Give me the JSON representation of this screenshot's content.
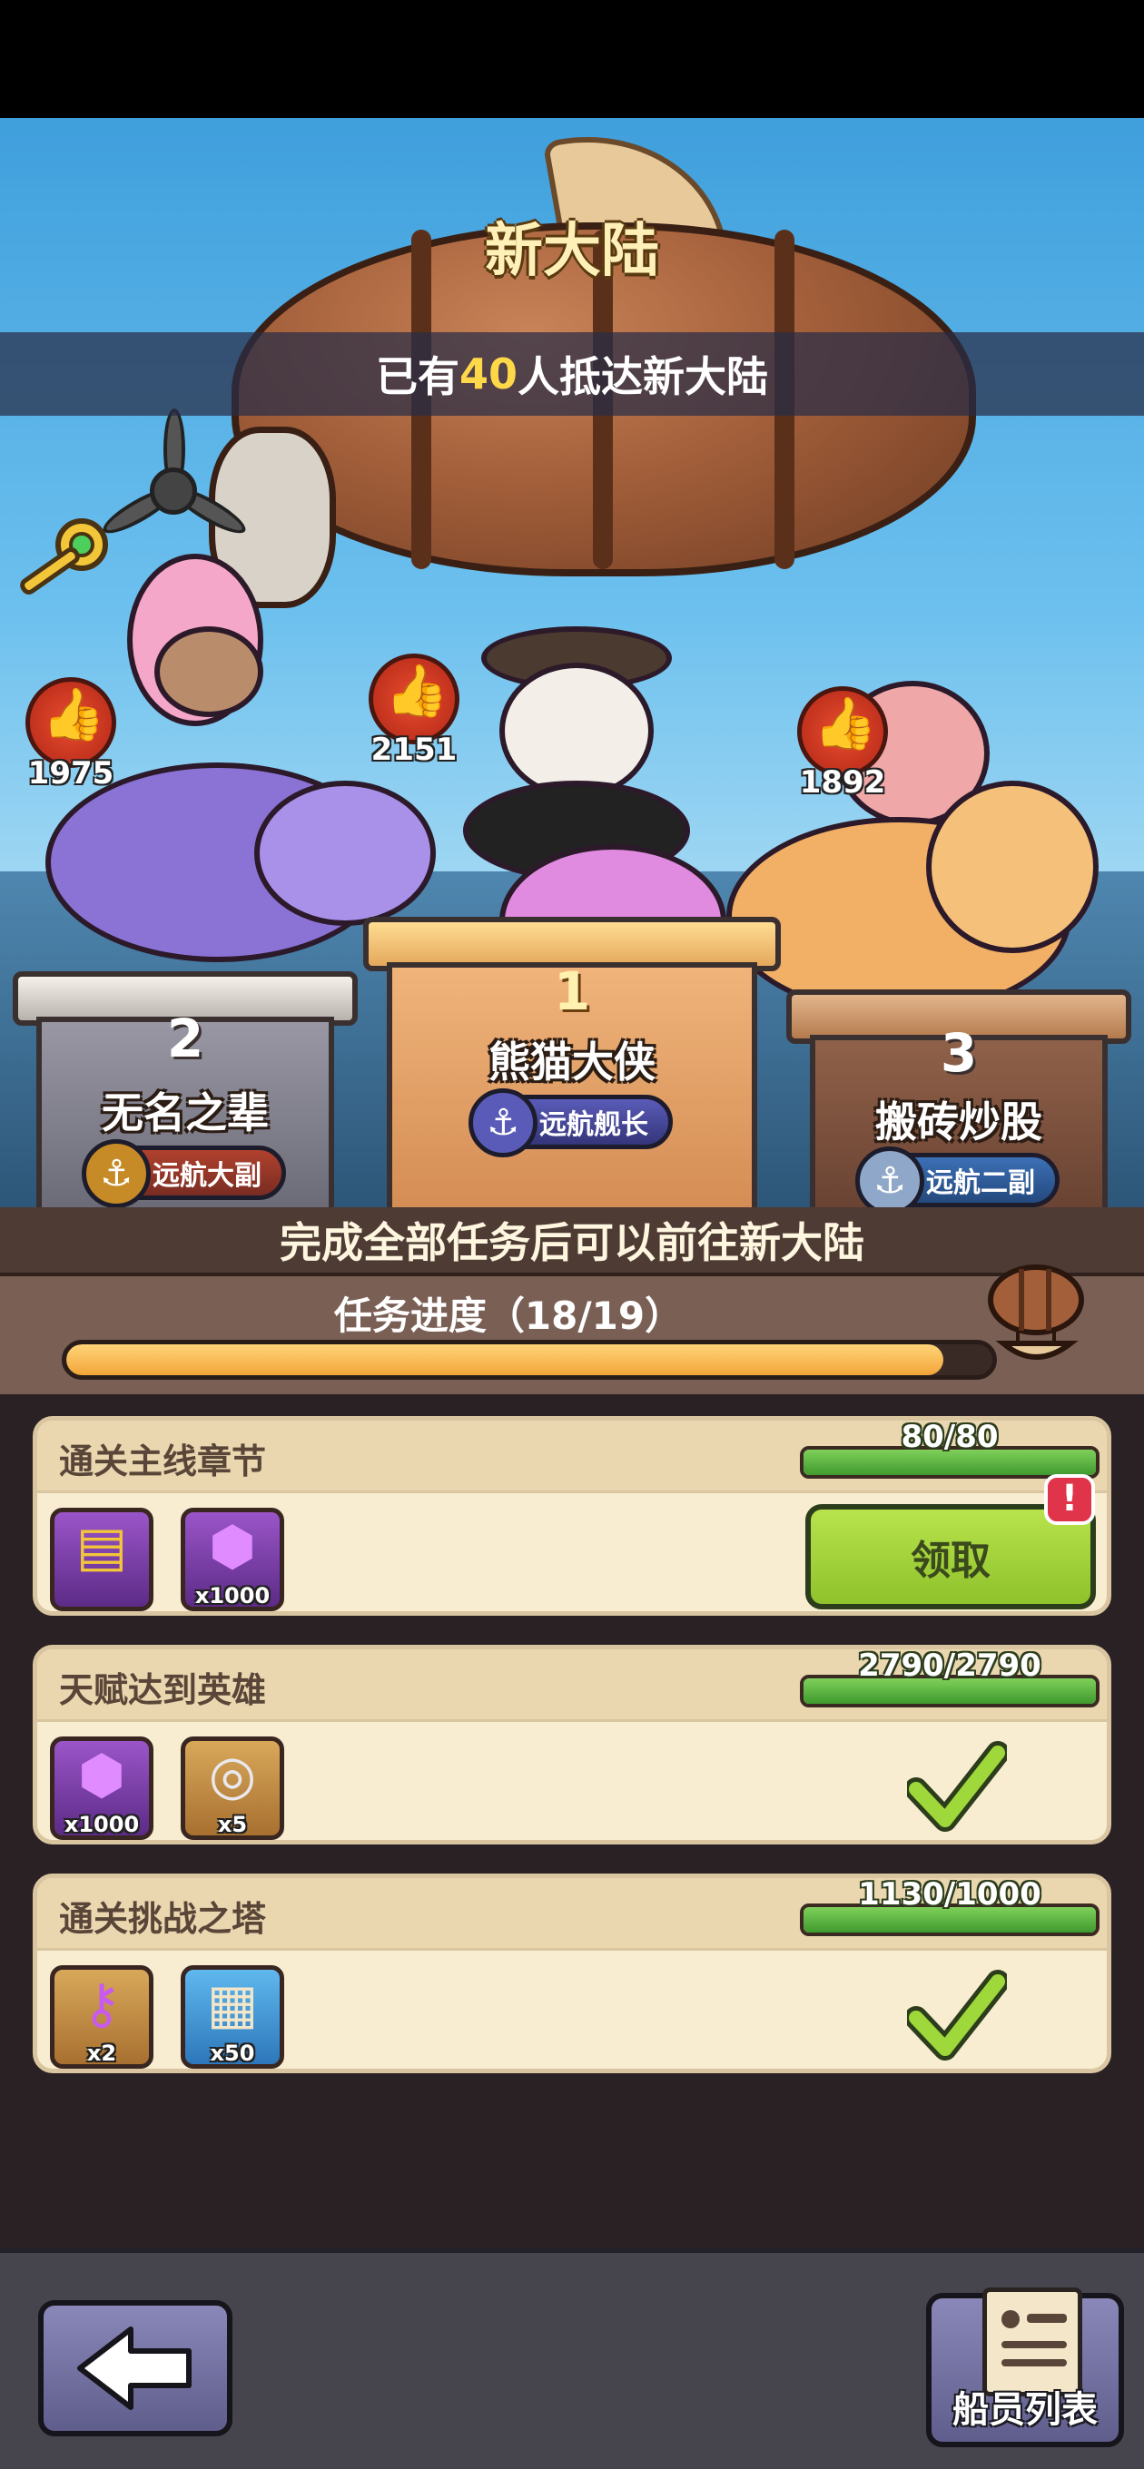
{
  "colors": {
    "sky_top": "#3f9fdc",
    "accent_gold": "#ffd84a",
    "gold_podium": "#e3a667",
    "progress_orange": "#f2a53a",
    "task_green": "#7fd05a",
    "claim_green": "#b8e34c",
    "alert_red": "#e0344a"
  },
  "header": {
    "title": "新大陆",
    "arrived_prefix": "已有",
    "arrived_count": "40",
    "arrived_suffix": "人抵达新大陆"
  },
  "leaderboard": [
    {
      "rank": "1",
      "name": "熊猫大侠",
      "title": "远航舰长",
      "likes": "2151",
      "badge_color": "#3c3d8a"
    },
    {
      "rank": "2",
      "name": "无名之辈",
      "title": "远航大副",
      "likes": "1975",
      "badge_color": "#7a2c22"
    },
    {
      "rank": "3",
      "name": "搬砖炒股",
      "title": "远航二副",
      "likes": "1892",
      "badge_color": "#2a4f84"
    }
  ],
  "unlock_notice": "完成全部任务后可以前往新大陆",
  "progress": {
    "label": "任务进度（18/19）",
    "current": 18,
    "total": 19
  },
  "tasks": [
    {
      "name": "通关主线章节",
      "count": "80/80",
      "fraction": 1.0,
      "rewards": [
        {
          "icon": "treasure-chest-icon",
          "glyph": "▤",
          "qty": "",
          "bg": "purple"
        },
        {
          "icon": "purple-gem-icon",
          "glyph": "⬢",
          "qty": "x1000",
          "bg": "purple"
        }
      ],
      "status": "claim",
      "claim_label": "领取",
      "alert_label": "!"
    },
    {
      "name": "天赋达到英雄",
      "count": "2790/2790",
      "fraction": 1.0,
      "rewards": [
        {
          "icon": "purple-gem-icon",
          "glyph": "⬢",
          "qty": "x1000",
          "bg": "purple"
        },
        {
          "icon": "silver-coin-icon",
          "glyph": "◎",
          "qty": "x5",
          "bg": "purple"
        }
      ],
      "status": "done"
    },
    {
      "name": "通关挑战之塔",
      "count": "1130/1000",
      "fraction": 1.0,
      "rewards": [
        {
          "icon": "purple-key-icon",
          "glyph": "⚷",
          "qty": "x2",
          "bg": "purple"
        },
        {
          "icon": "blue-scroll-icon",
          "glyph": "▦",
          "qty": "x50",
          "bg": "blue"
        }
      ],
      "status": "done"
    }
  ],
  "nav": {
    "crew_label": "船员列表",
    "back_icon": "back-arrow-icon"
  }
}
